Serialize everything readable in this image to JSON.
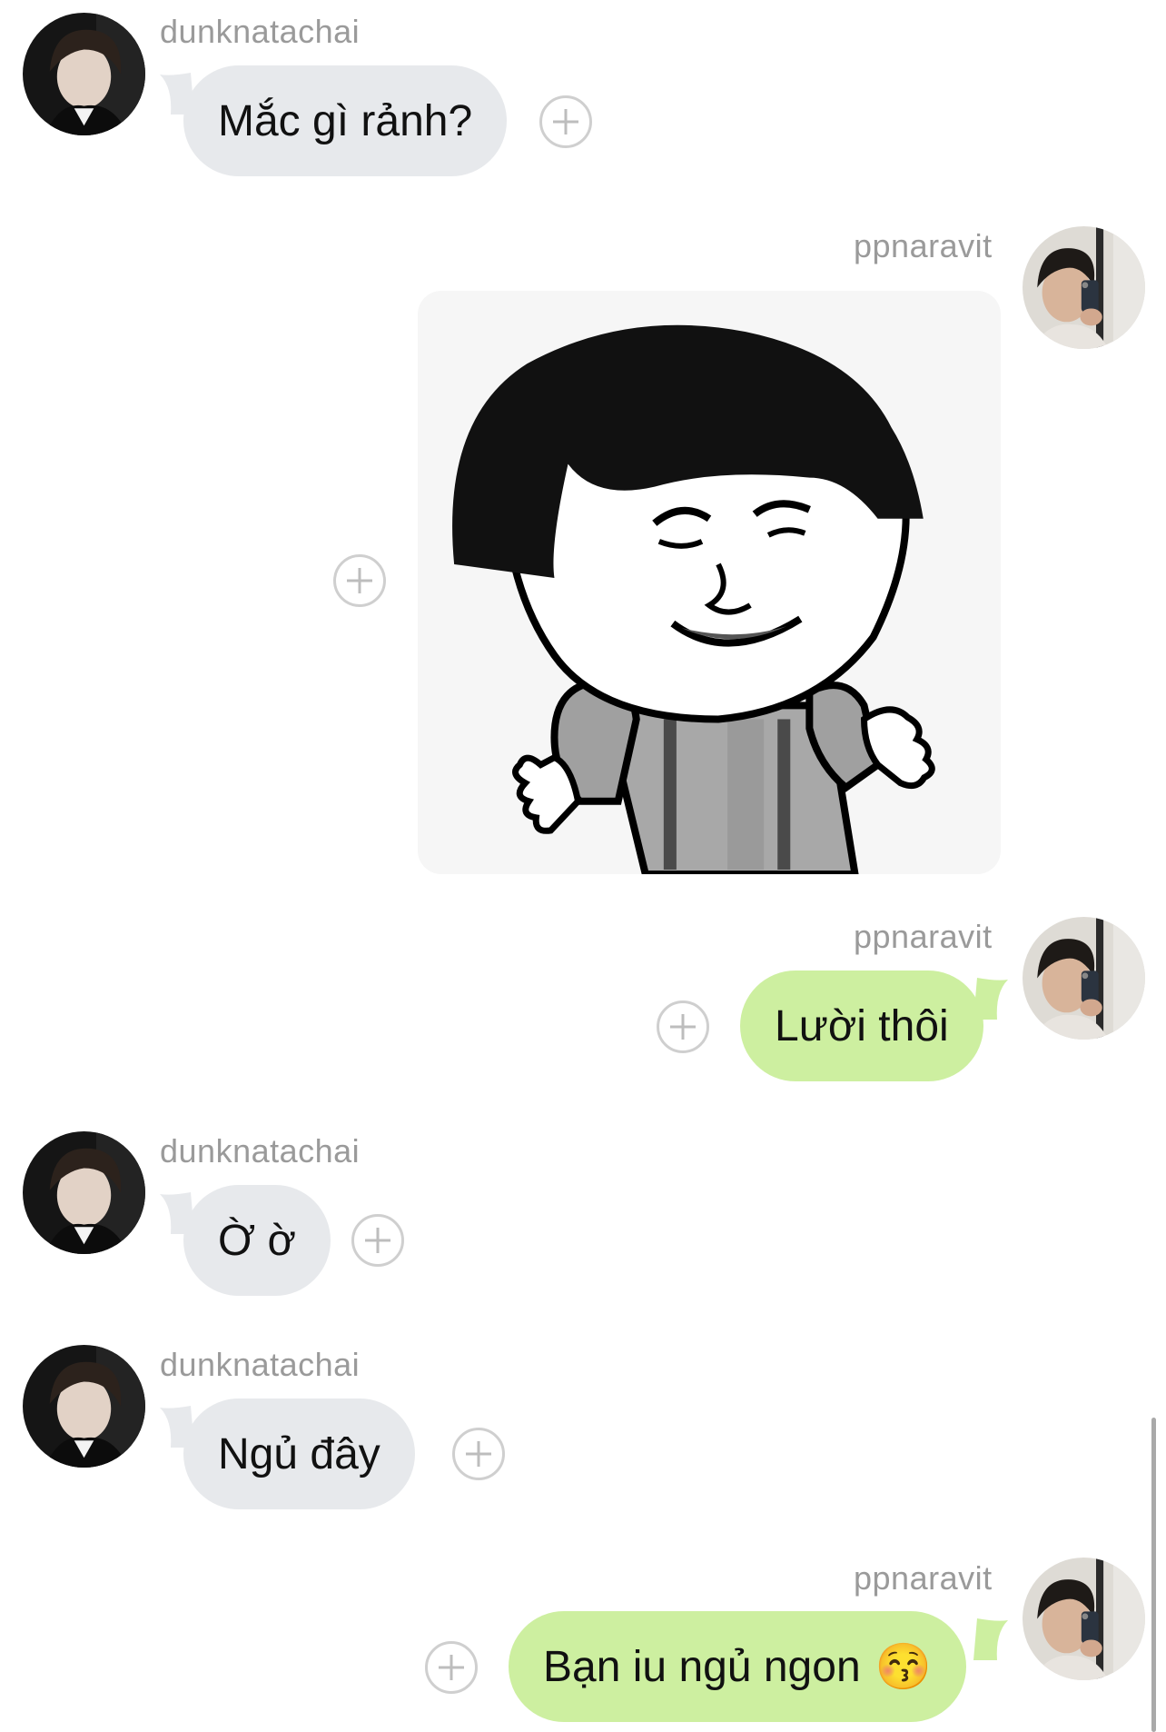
{
  "colors": {
    "incoming_bubble": "#e7e9ec",
    "outgoing_bubble": "#cdefa0",
    "username": "#9a9a9a",
    "background": "#ffffff"
  },
  "messages": [
    {
      "sender": "dunknatachai",
      "direction": "incoming",
      "text": "Mắc gì rảnh?"
    },
    {
      "sender": "ppnaravit",
      "direction": "outgoing",
      "type": "sticker",
      "sticker_icon": "shrugging-bowl-cut-meme-sticker"
    },
    {
      "sender": "ppnaravit",
      "direction": "outgoing",
      "text": "Lười thôi"
    },
    {
      "sender": "dunknatachai",
      "direction": "incoming",
      "text": "Ờ ờ"
    },
    {
      "sender": "dunknatachai",
      "direction": "incoming",
      "text": "Ngủ đây"
    },
    {
      "sender": "ppnaravit",
      "direction": "outgoing",
      "text": "Bạn iu ngủ ngon",
      "emoji": "😚"
    }
  ]
}
